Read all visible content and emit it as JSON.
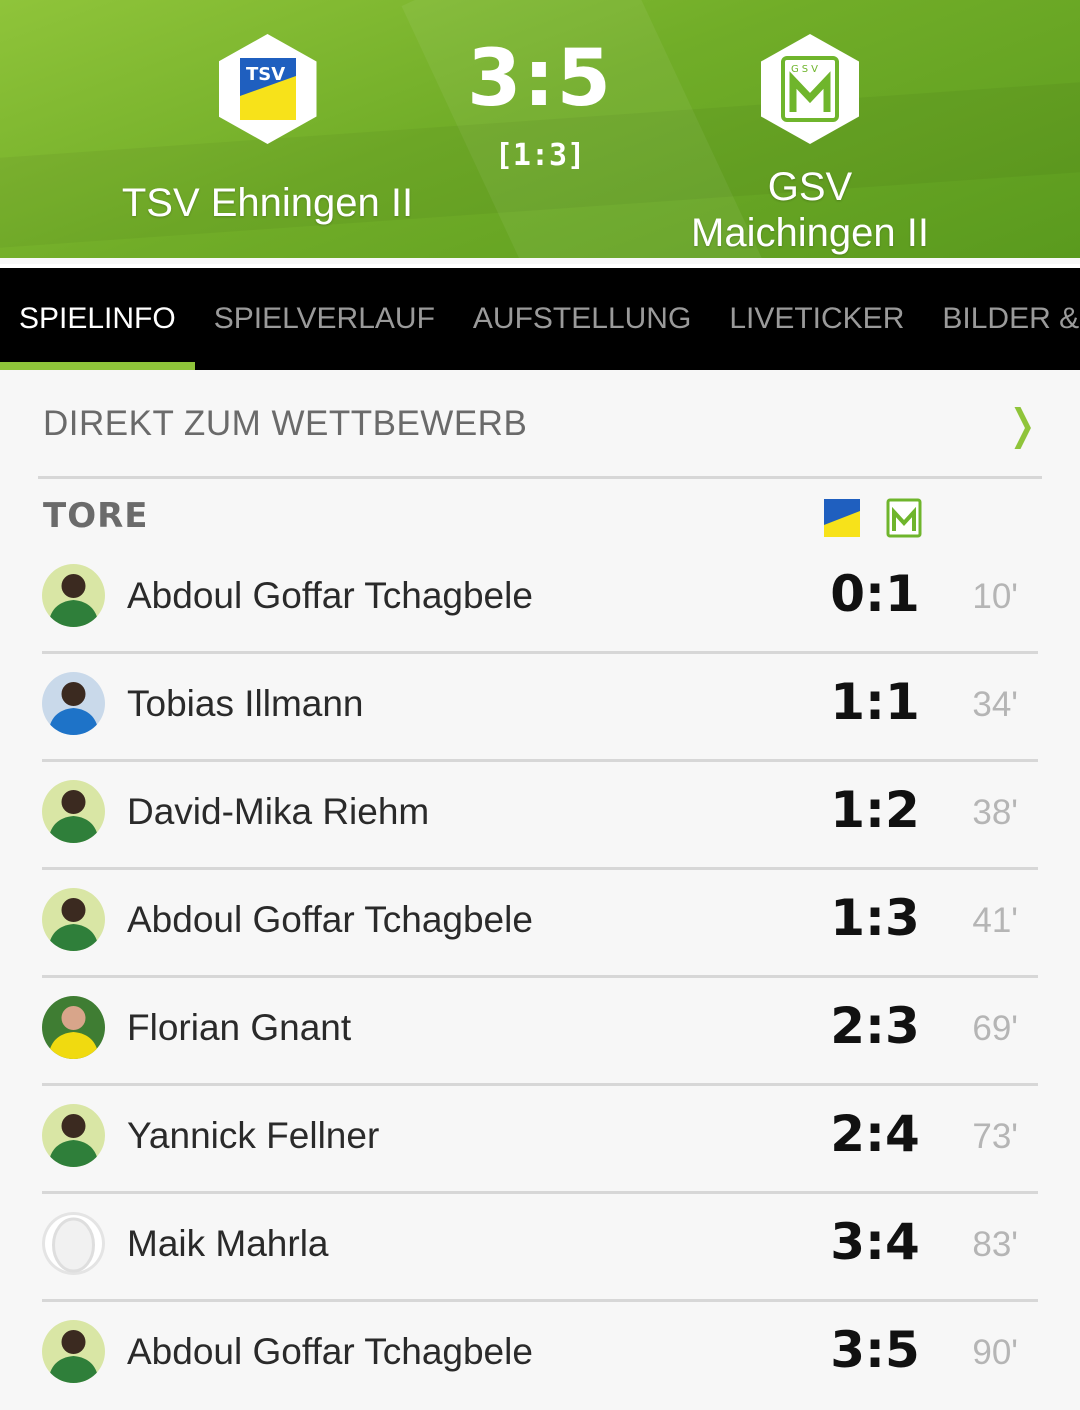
{
  "match": {
    "home_team": "TSV Ehningen II",
    "away_team_line1": "GSV",
    "away_team_line2": "Maichingen II",
    "score": "3:5",
    "halftime": "[1:3]",
    "home_logo_text": "TSV",
    "away_logo_text": "GSV"
  },
  "tabs": [
    {
      "label": "SPIELINFO",
      "active": true
    },
    {
      "label": "SPIELVERLAUF",
      "active": false
    },
    {
      "label": "AUFSTELLUNG",
      "active": false
    },
    {
      "label": "LIVETICKER",
      "active": false
    },
    {
      "label": "BILDER & V",
      "active": false
    }
  ],
  "competition_link": {
    "label": "DIREKT ZUM WETTBEWERB",
    "icon": "chevron-right-icon"
  },
  "goals": {
    "title": "TORE",
    "rows": [
      {
        "player": "Abdoul Goffar Tchagbele",
        "score": "0:1",
        "minute": "10'",
        "avatar": "green-jersey"
      },
      {
        "player": "Tobias Illmann",
        "score": "1:1",
        "minute": "34'",
        "avatar": "blue-jersey"
      },
      {
        "player": "David-Mika Riehm",
        "score": "1:2",
        "minute": "38'",
        "avatar": "green-jersey"
      },
      {
        "player": "Abdoul Goffar Tchagbele",
        "score": "1:3",
        "minute": "41'",
        "avatar": "green-jersey"
      },
      {
        "player": "Florian Gnant",
        "score": "2:3",
        "minute": "69'",
        "avatar": "yellow-jersey"
      },
      {
        "player": "Yannick Fellner",
        "score": "2:4",
        "minute": "73'",
        "avatar": "green-jersey"
      },
      {
        "player": "Maik Mahrla",
        "score": "3:4",
        "minute": "83'",
        "avatar": "placeholder"
      },
      {
        "player": "Abdoul Goffar Tchagbele",
        "score": "3:5",
        "minute": "90'",
        "avatar": "green-jersey"
      }
    ]
  },
  "colors": {
    "accent": "#8fc43a",
    "header_dark": "#5a9a1e",
    "tabbar": "#000000"
  }
}
